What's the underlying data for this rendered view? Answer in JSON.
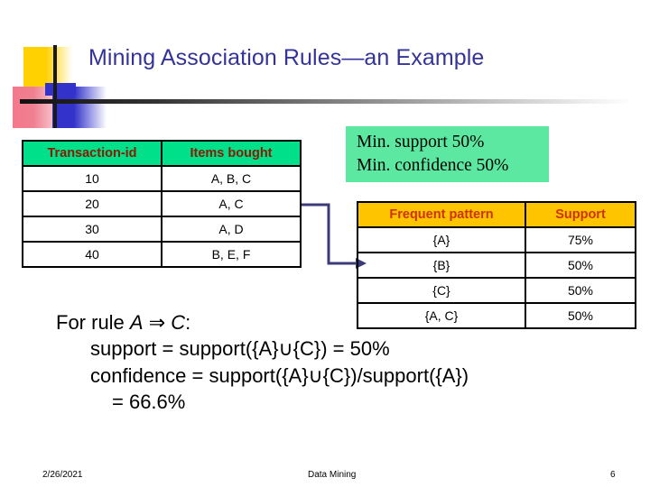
{
  "slide": {
    "title": "Mining Association Rules—an Example",
    "title_color": "#333399"
  },
  "decoration": {
    "yellow_color": "#FFD100",
    "blue_color": "#3333CC",
    "red_color": "#F08090",
    "rule_color": "#111111"
  },
  "transaction_table": {
    "headers": [
      "Transaction-id",
      "Items bought"
    ],
    "header_bg": "#00E08A",
    "header_text_color": "#8B1A00",
    "rows": [
      [
        "10",
        "A, B, C"
      ],
      [
        "20",
        "A, C"
      ],
      [
        "30",
        "A, D"
      ],
      [
        "40",
        "B, E, F"
      ]
    ]
  },
  "min_box": {
    "line1": "Min. support 50%",
    "line2": "Min. confidence 50%",
    "bg": "#5CE8A0"
  },
  "frequent_pattern_table": {
    "headers": [
      "Frequent pattern",
      "Support"
    ],
    "header_bg": "#FFC400",
    "header_text_color": "#CC3300",
    "rows": [
      [
        "{A}",
        "75%"
      ],
      [
        "{B}",
        "50%"
      ],
      [
        "{C}",
        "50%"
      ],
      [
        "{A, C}",
        "50%"
      ]
    ]
  },
  "connector": {
    "color": "#3B3B78"
  },
  "formula": {
    "rule_prefix": "For rule ",
    "rule_antecedent": "A",
    "rule_arrow": " ⇒ ",
    "rule_consequent": "C",
    "rule_suffix": ":",
    "support_line": "support = support({A}∪{C}) = 50%",
    "confidence_line": "confidence = support({A}∪{C})/support({A})",
    "confidence_value": "= 66.6%"
  },
  "footer": {
    "date": "2/26/2021",
    "title": "Data Mining",
    "page": "6"
  }
}
